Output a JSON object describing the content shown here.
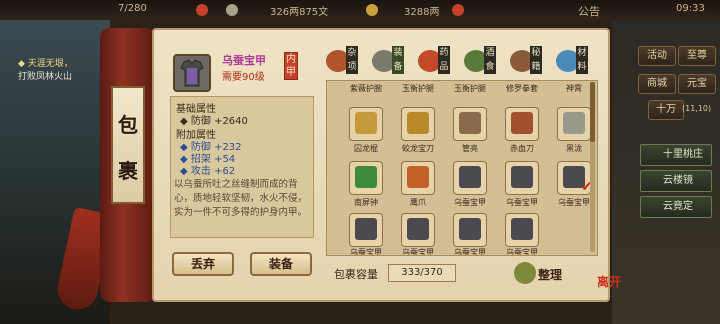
{
  "hud": {
    "stamina": "7/280",
    "silver": "326两875文",
    "gold": "3288两",
    "notice_label": "公告",
    "clock": "09:33"
  },
  "quest": {
    "title": "天涯无垠，",
    "subtitle": "打败凤林火山"
  },
  "right_menu": {
    "top_buttons": [
      "活动",
      "至尊",
      "商城",
      "元宝",
      "十万"
    ],
    "coord": "(11,10)",
    "wide_buttons": [
      "十里桃庄",
      "云楼镜",
      "云竟定"
    ]
  },
  "scroll": {
    "bag_title_chars": [
      "包",
      "裹"
    ]
  },
  "selected_item": {
    "name": "乌蚕宝甲",
    "requirement": "需要90级",
    "slot_tag": "内甲",
    "base_header": "基础属性",
    "base_attrs": [
      {
        "label": "防御",
        "value": "+2640"
      }
    ],
    "extra_header": "附加属性",
    "extra_attrs": [
      {
        "label": "防御",
        "value": "+232"
      },
      {
        "label": "招架",
        "value": "+54"
      },
      {
        "label": "攻击",
        "value": "+62"
      }
    ],
    "description": "以乌蚕所吐之丝缝制而成的背心，质地轻软坚韧，水火不侵，实为一件不可多得的护身内甲。"
  },
  "actions": {
    "discard_label": "丢弃",
    "equip_label": "装备"
  },
  "tabs": [
    {
      "label": "杂项",
      "icon": "misc-jar-icon",
      "color": "#b0542e"
    },
    {
      "label": "装备",
      "icon": "equipment-sword-icon",
      "color": "#7a7a6a"
    },
    {
      "label": "药品",
      "icon": "medicine-icon",
      "color": "#c24a2a"
    },
    {
      "label": "酒食",
      "icon": "food-wine-icon",
      "color": "#5a7a3a"
    },
    {
      "label": "秘籍",
      "icon": "manual-book-icon",
      "color": "#8a5a3a"
    },
    {
      "label": "材料",
      "icon": "material-gem-icon",
      "color": "#4a8ab8"
    }
  ],
  "inventory": {
    "rows": [
      [
        "紫薇护腕",
        "玉衡护腿",
        "玉衡护腿",
        "修罗拳套",
        "神霄"
      ],
      [
        "囚龙棍",
        "蛟龙宝刀",
        "管亮",
        "赤血刀",
        "黑泷"
      ],
      [
        "南屏钟",
        "鹰爪",
        "乌蚕宝甲",
        "乌蚕宝甲",
        "乌蚕宝甲"
      ],
      [
        "乌蚕宝甲",
        "乌蚕宝甲",
        "乌蚕宝甲",
        "乌蚕宝甲",
        ""
      ]
    ],
    "capacity_label": "包裹容量",
    "capacity_value": "333/370",
    "sort_label": "整理"
  },
  "close_seal": "离开"
}
